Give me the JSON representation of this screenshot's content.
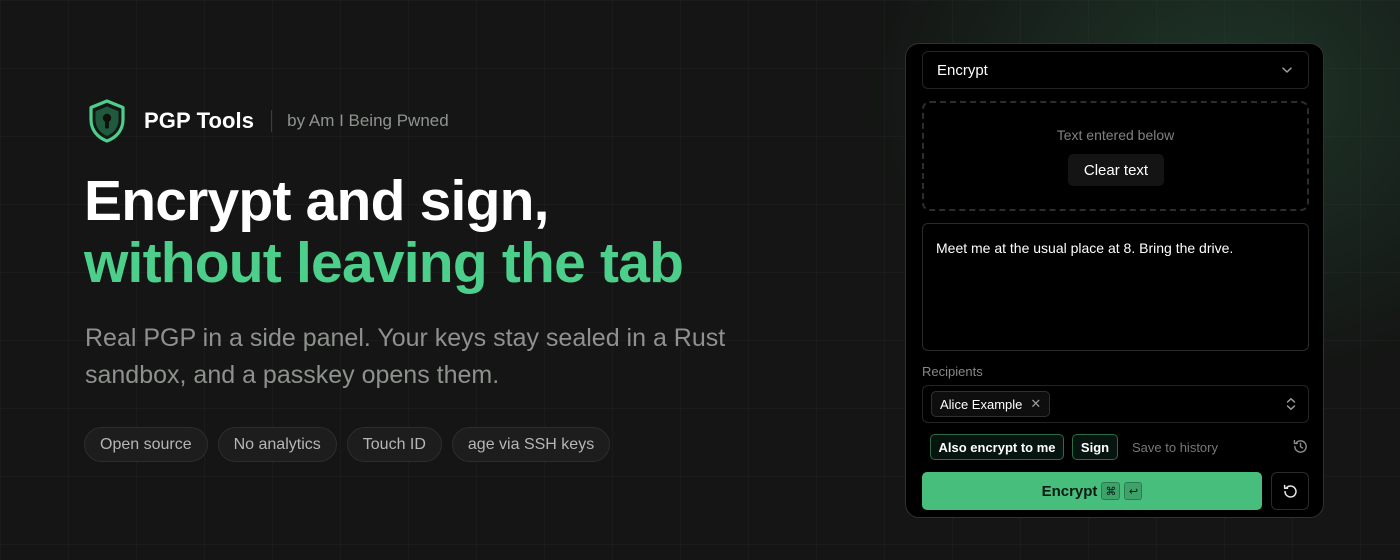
{
  "brand": {
    "name": "PGP Tools",
    "byline": "by Am I Being Pwned",
    "logo_icon": "shield-keyhole-icon"
  },
  "hero": {
    "headline_line1": "Encrypt and sign,",
    "headline_line2": "without leaving the tab",
    "subtitle": "Real PGP in a side panel. Your keys stay sealed in a Rust sandbox, and a passkey opens them.",
    "tags": [
      "Open source",
      "No analytics",
      "Touch ID",
      "age via SSH keys"
    ]
  },
  "panel": {
    "mode_select": {
      "value": "Encrypt",
      "icon": "chevron-down-icon"
    },
    "dropzone": {
      "status_text": "Text entered below",
      "clear_label": "Clear text"
    },
    "message": {
      "value": "Meet me at the usual place at 8. Bring the drive."
    },
    "recipients": {
      "label": "Recipients",
      "selected": [
        {
          "name": "Alice Example",
          "remove_glyph": "✕"
        }
      ],
      "icon": "chevrons-up-down-icon"
    },
    "options": {
      "also_encrypt_label": "Also encrypt to me",
      "also_encrypt_on": true,
      "sign_label": "Sign",
      "sign_on": true,
      "save_history_label": "Save to history",
      "save_history_on": false,
      "history_icon": "history-icon"
    },
    "encrypt_button": {
      "label": "Encrypt",
      "shortcut_keys": [
        "⌘",
        "↩"
      ]
    },
    "reset_icon": "rotate-ccw-icon"
  },
  "colors": {
    "background": "#141514",
    "accent": "#4ccf8b",
    "button_green": "#48be7c",
    "panel": "#000000",
    "muted_text": "#8e918e"
  }
}
